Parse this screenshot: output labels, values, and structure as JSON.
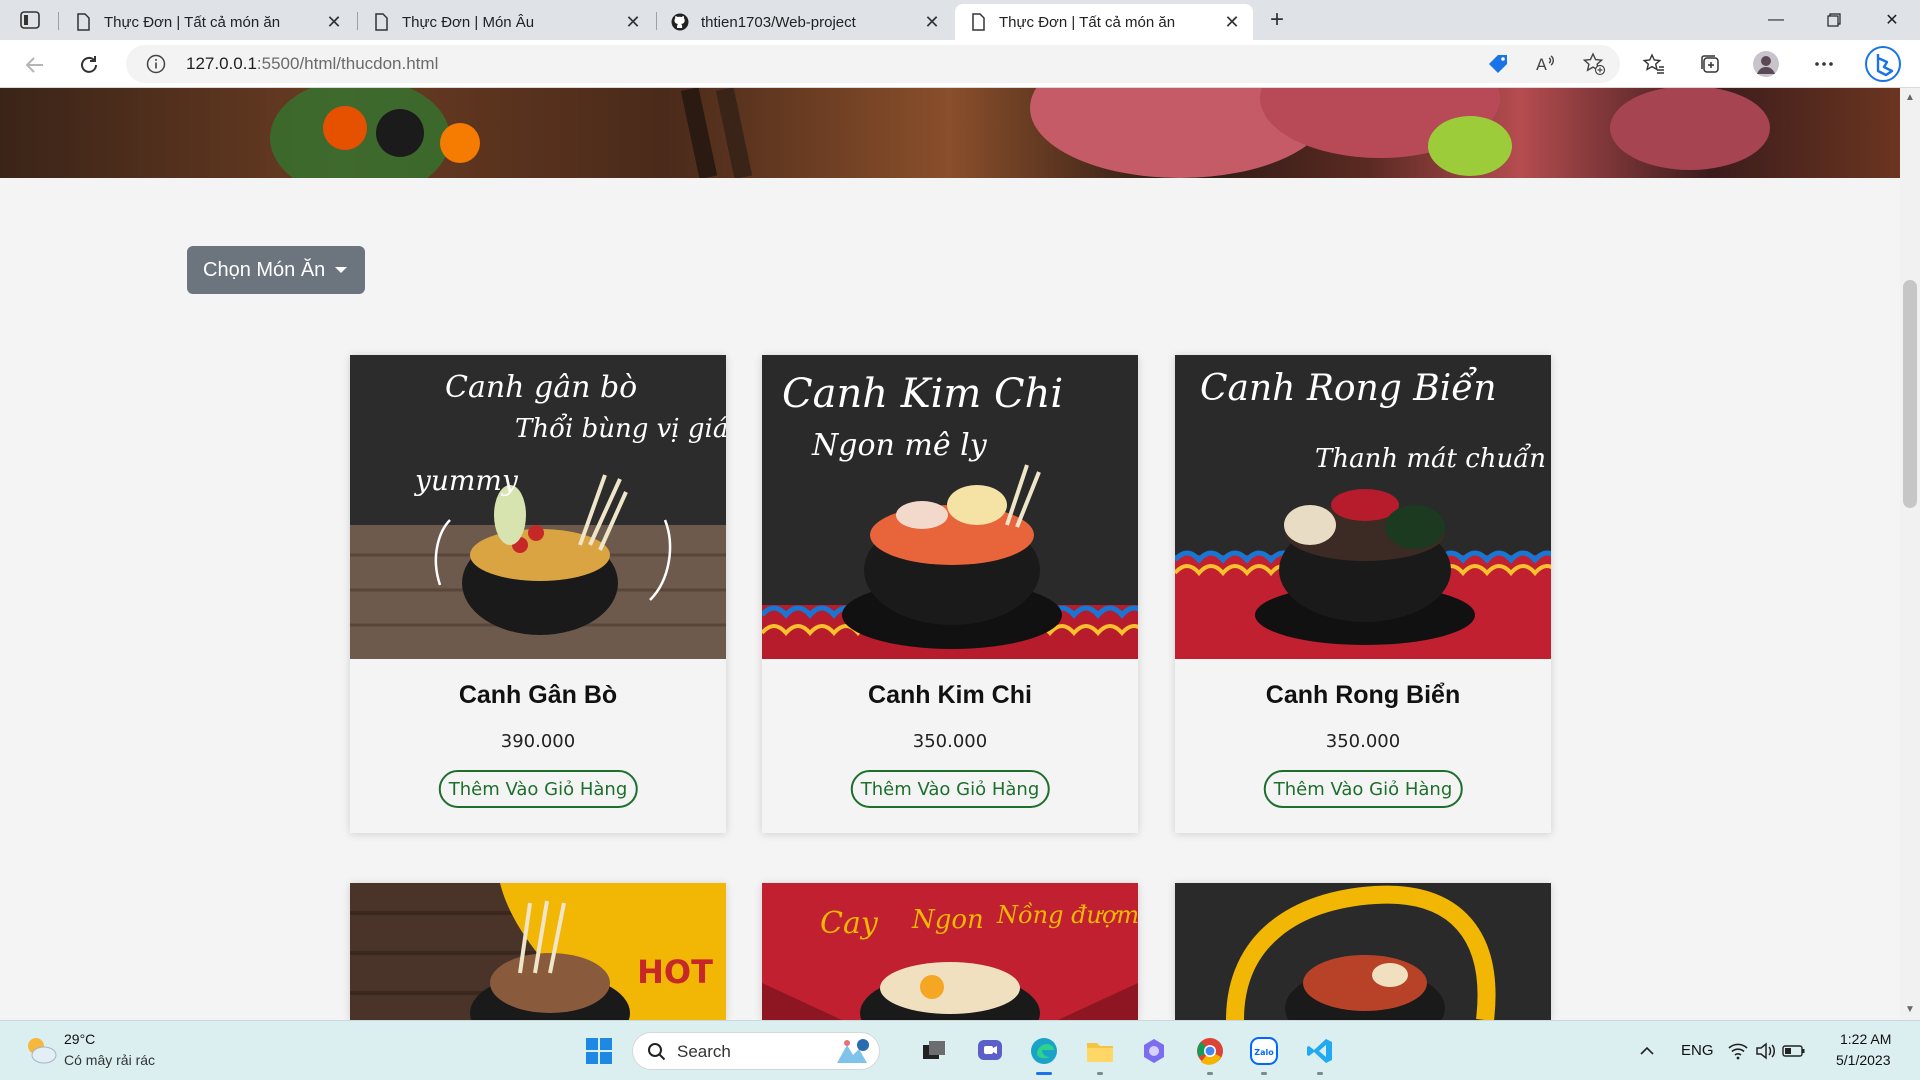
{
  "browser": {
    "tabs": [
      {
        "title": "Thực Đơn | Tất cả món ăn",
        "active": false,
        "icon": "page-icon"
      },
      {
        "title": "Thực Đơn | Món Âu",
        "active": false,
        "icon": "page-icon"
      },
      {
        "title": "thtien1703/Web-project",
        "active": false,
        "icon": "github-icon"
      },
      {
        "title": "Thực Đơn | Tất cả món ăn",
        "active": true,
        "icon": "page-icon"
      }
    ],
    "address": {
      "host": "127.0.0.1",
      "path": ":5500/html/thucdon.html"
    }
  },
  "page": {
    "dropdown_label": "Chọn Món Ăn",
    "cards": [
      {
        "name": "Canh Gân Bò",
        "price": "390.000",
        "button": "Thêm Vào Giỏ Hàng",
        "art_lines": [
          "Canh gân bò",
          "Thổi bùng vị giác",
          "yummy"
        ]
      },
      {
        "name": "Canh Kim Chi",
        "price": "350.000",
        "button": "Thêm Vào Giỏ Hàng",
        "art_lines": [
          "Canh Kim Chi",
          "Ngon mê ly"
        ]
      },
      {
        "name": "Canh Rong Biển",
        "price": "350.000",
        "button": "Thêm Vào Giỏ Hàng",
        "art_lines": [
          "Canh Rong Biển",
          "Thanh mát chuẩn vị"
        ]
      }
    ],
    "partial_cards": [
      {
        "art_lines": [
          "HOT"
        ]
      },
      {
        "art_lines": [
          "Cay",
          "Ngon",
          "Nồng đượm"
        ]
      },
      {
        "art_lines": []
      }
    ]
  },
  "taskbar": {
    "weather_temp": "29°C",
    "weather_desc": "Có mây rải rác",
    "search_label": "Search",
    "language": "ENG",
    "time": "1:22 AM",
    "date": "5/1/2023"
  },
  "colors": {
    "accent_green": "#1e6e2d",
    "dropdown_gray": "#6c757d",
    "taskbar_bg": "#dbeef0"
  }
}
